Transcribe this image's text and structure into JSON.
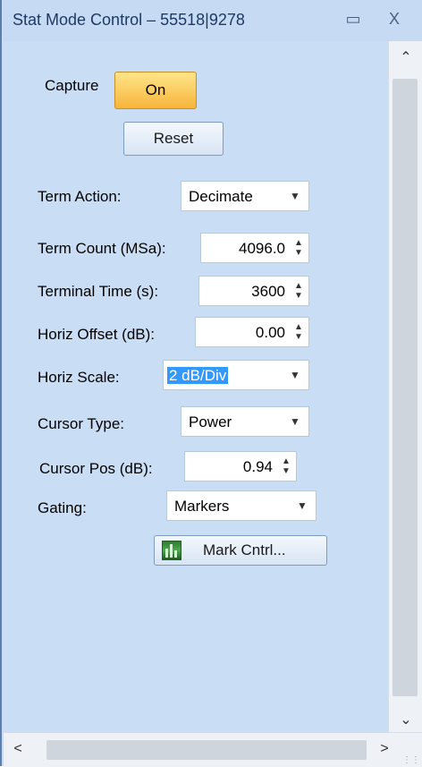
{
  "window": {
    "title": "Stat Mode Control – 55518|9278",
    "restore_icon": "restore-icon",
    "close_label": "X"
  },
  "capture": {
    "label": "Capture",
    "button": "On"
  },
  "reset": {
    "button": "Reset"
  },
  "term_action": {
    "label": "Term Action:",
    "value": "Decimate"
  },
  "term_count": {
    "label": "Term Count (MSa):",
    "value": "4096.0"
  },
  "terminal_time": {
    "label": "Terminal Time (s):",
    "value": "3600"
  },
  "horiz_offset": {
    "label": "Horiz Offset (dB):",
    "value": "0.00"
  },
  "horiz_scale": {
    "label": "Horiz Scale:",
    "value": "2 dB/Div"
  },
  "cursor_type": {
    "label": "Cursor Type:",
    "value": "Power"
  },
  "cursor_pos": {
    "label": "Cursor Pos (dB):",
    "value": "0.94"
  },
  "gating": {
    "label": "Gating:",
    "value": "Markers"
  },
  "mark_cntrl": {
    "button": "Mark Cntrl..."
  },
  "colors": {
    "panel": "#c9def5",
    "on_button": "#f7b53c",
    "selection": "#3399ff"
  }
}
